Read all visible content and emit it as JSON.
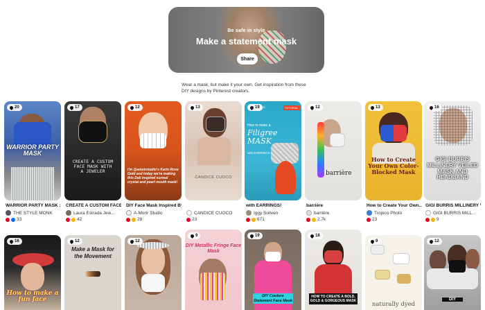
{
  "hero": {
    "kicker": "Be safe in style",
    "title": "Make a statement mask",
    "share_label": "Share"
  },
  "intro": "Wear a mask, but make it your own. Get inspiration from these DIY designs by Pinterest creators.",
  "pins_row1": [
    {
      "count": "20",
      "overlay": "WARRIOR PARTY MASK",
      "title": "WARRIOR PARTY MASK : A...",
      "creator": "THE STYLE MONK",
      "reactions": "33"
    },
    {
      "count": "17",
      "overlay": "CREATE A CUSTOM FACE MASK WITH A JEWELER",
      "title": "CREATE A CUSTOM FACE MASK WITH...",
      "creator": "Laura Estrada Jew...",
      "reactions": "42"
    },
    {
      "count": "12",
      "overlay": "I'm @amoirstudio's Karin Rose Gold and today we're making this Dali inspired surreal crystal and pearl mouth mask!",
      "title": "DIY Face Mask Inspired By...",
      "creator": "A-Morir Studio",
      "reactions": "28"
    },
    {
      "count": "13",
      "overlay": "CANDICE CUOCO",
      "title": "",
      "creator": "CANDICE CUOCO",
      "reactions": "23"
    },
    {
      "count": "19",
      "overlay_small": "How to make a",
      "overlay": "Filigree MASK",
      "overlay_sub": "with EARRINGS",
      "tag1": "DIY FILIGREE",
      "tag2": "TUTORIAL",
      "title": "with EARRINGS!",
      "creator": "Iggy Soliven",
      "reactions": "671"
    },
    {
      "count": "12",
      "overlay": "barrière",
      "title": "barrière",
      "creator": "barrière",
      "reactions": "2.7k"
    },
    {
      "count": "13",
      "overlay": "How to Create Your Own Color-Blocked Mask",
      "title": "How to Create Your Own...",
      "creator": "Tropico Photo",
      "reactions": "23"
    },
    {
      "count": "16",
      "overlay": "GIGI BURRIS MILLINERY VEILED MASK AND HEADBAND",
      "title": "GIGI BURRIS MILLINERY VEILED...",
      "creator": "GIGI BURRIS MILL...",
      "reactions": "9"
    }
  ],
  "pins_row2": [
    {
      "count": "16",
      "overlay": "How to make a fun face"
    },
    {
      "count": "12",
      "overlay": "Make a Mask for the Movement"
    },
    {
      "count": "12",
      "overlay": ""
    },
    {
      "count": "9",
      "overlay": "DIY Metallic Fringe Face Mask"
    },
    {
      "count": "19",
      "overlay": "DIY Couture Statement Face Mask"
    },
    {
      "count": "18",
      "overlay": "HOW TO CREATE A BOLD, GOLD & GORGEOUS MASK"
    },
    {
      "count": "9",
      "overlay": "naturally dyed"
    },
    {
      "count": "12",
      "overlay": "DIY"
    }
  ],
  "colors": {
    "accent": "#e60023",
    "badge_bg": "#ffffff"
  }
}
